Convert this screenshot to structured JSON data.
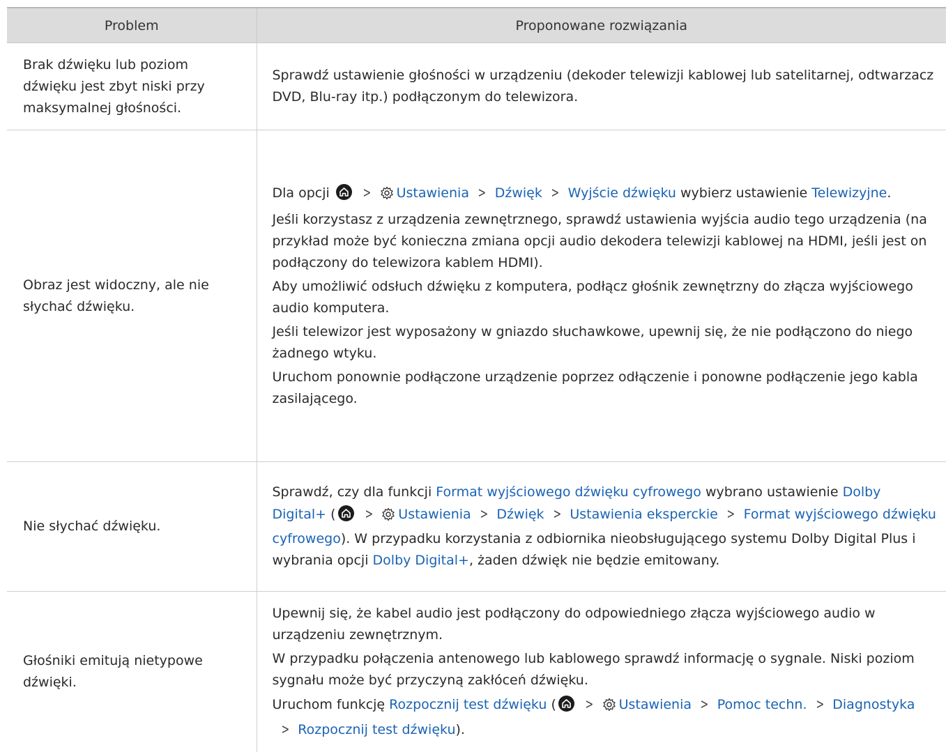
{
  "header": {
    "problem": "Problem",
    "solution": "Proponowane rozwiązania"
  },
  "rows": [
    {
      "problem": "Brak dźwięku lub poziom dźwięku jest zbyt niski przy maksymalnej głośności.",
      "solution_text": "Sprawdź ustawienie głośności w urządzeniu (dekoder telewizji kablowej lub satelitarnej, odtwarzacz DVD, Blu-ray itp.) podłączonym do telewizora."
    },
    {
      "problem": "Obraz jest widoczny, ale nie słychać dźwięku.",
      "p1_prefix": "Dla opcji",
      "p1_link1": "Ustawienia",
      "p1_link2": "Dźwięk",
      "p1_link3": "Wyjście dźwięku",
      "p1_mid": "wybierz ustawienie",
      "p1_link4": "Telewizyjne",
      "p1_end": ".",
      "p2": "Jeśli korzystasz z urządzenia zewnętrznego, sprawdź ustawienia wyjścia audio tego urządzenia (na przykład może być konieczna zmiana opcji audio dekodera telewizji kablowej na HDMI, jeśli jest on podłączony do telewizora kablem HDMI).",
      "p3": "Aby umożliwić odsłuch dźwięku z komputera, podłącz głośnik zewnętrzny do złącza wyjściowego audio komputera.",
      "p4": "Jeśli telewizor jest wyposażony w gniazdo słuchawkowe, upewnij się, że nie podłączono do niego żadnego wtyku.",
      "p5": "Uruchom ponownie podłączone urządzenie poprzez odłączenie i ponowne podłączenie jego kabla zasilającego."
    },
    {
      "problem": "Nie słychać dźwięku.",
      "t1": "Sprawdź, czy dla funkcji",
      "l1": "Format wyjściowego dźwięku cyfrowego",
      "t2": "wybrano ustawienie",
      "l2": "Dolby Digital+",
      "t3": "(",
      "l3": "Ustawienia",
      "l4": "Dźwięk",
      "l5": "Ustawienia eksperckie",
      "l6": "Format wyjściowego dźwięku cyfrowego",
      "t4": "). W przypadku korzystania z odbiornika nieobsługującego systemu Dolby Digital Plus i wybrania opcji",
      "l7": "Dolby Digital+",
      "t5": ", żaden dźwięk nie będzie emitowany."
    },
    {
      "problem": "Głośniki emitują nietypowe dźwięki.",
      "p1": "Upewnij się, że kabel audio jest podłączony do odpowiedniego złącza wyjściowego audio w urządzeniu zewnętrznym.",
      "p2": "W przypadku połączenia antenowego lub kablowego sprawdź informację o sygnale. Niski poziom sygnału może być przyczyną zakłóceń dźwięku.",
      "t1": "Uruchom funkcję",
      "l1": "Rozpocznij test dźwięku",
      "t2": "(",
      "l2": "Ustawienia",
      "l3": "Pomoc techn.",
      "l4": "Diagnostyka",
      "l5": "Rozpocznij test dźwięku",
      "t3": ")."
    }
  ],
  "colors": {
    "link": "#1a63b4",
    "header_bg": "#dcdcdc"
  },
  "icons": [
    "home-icon",
    "gear-icon",
    "chevron-right-icon"
  ]
}
